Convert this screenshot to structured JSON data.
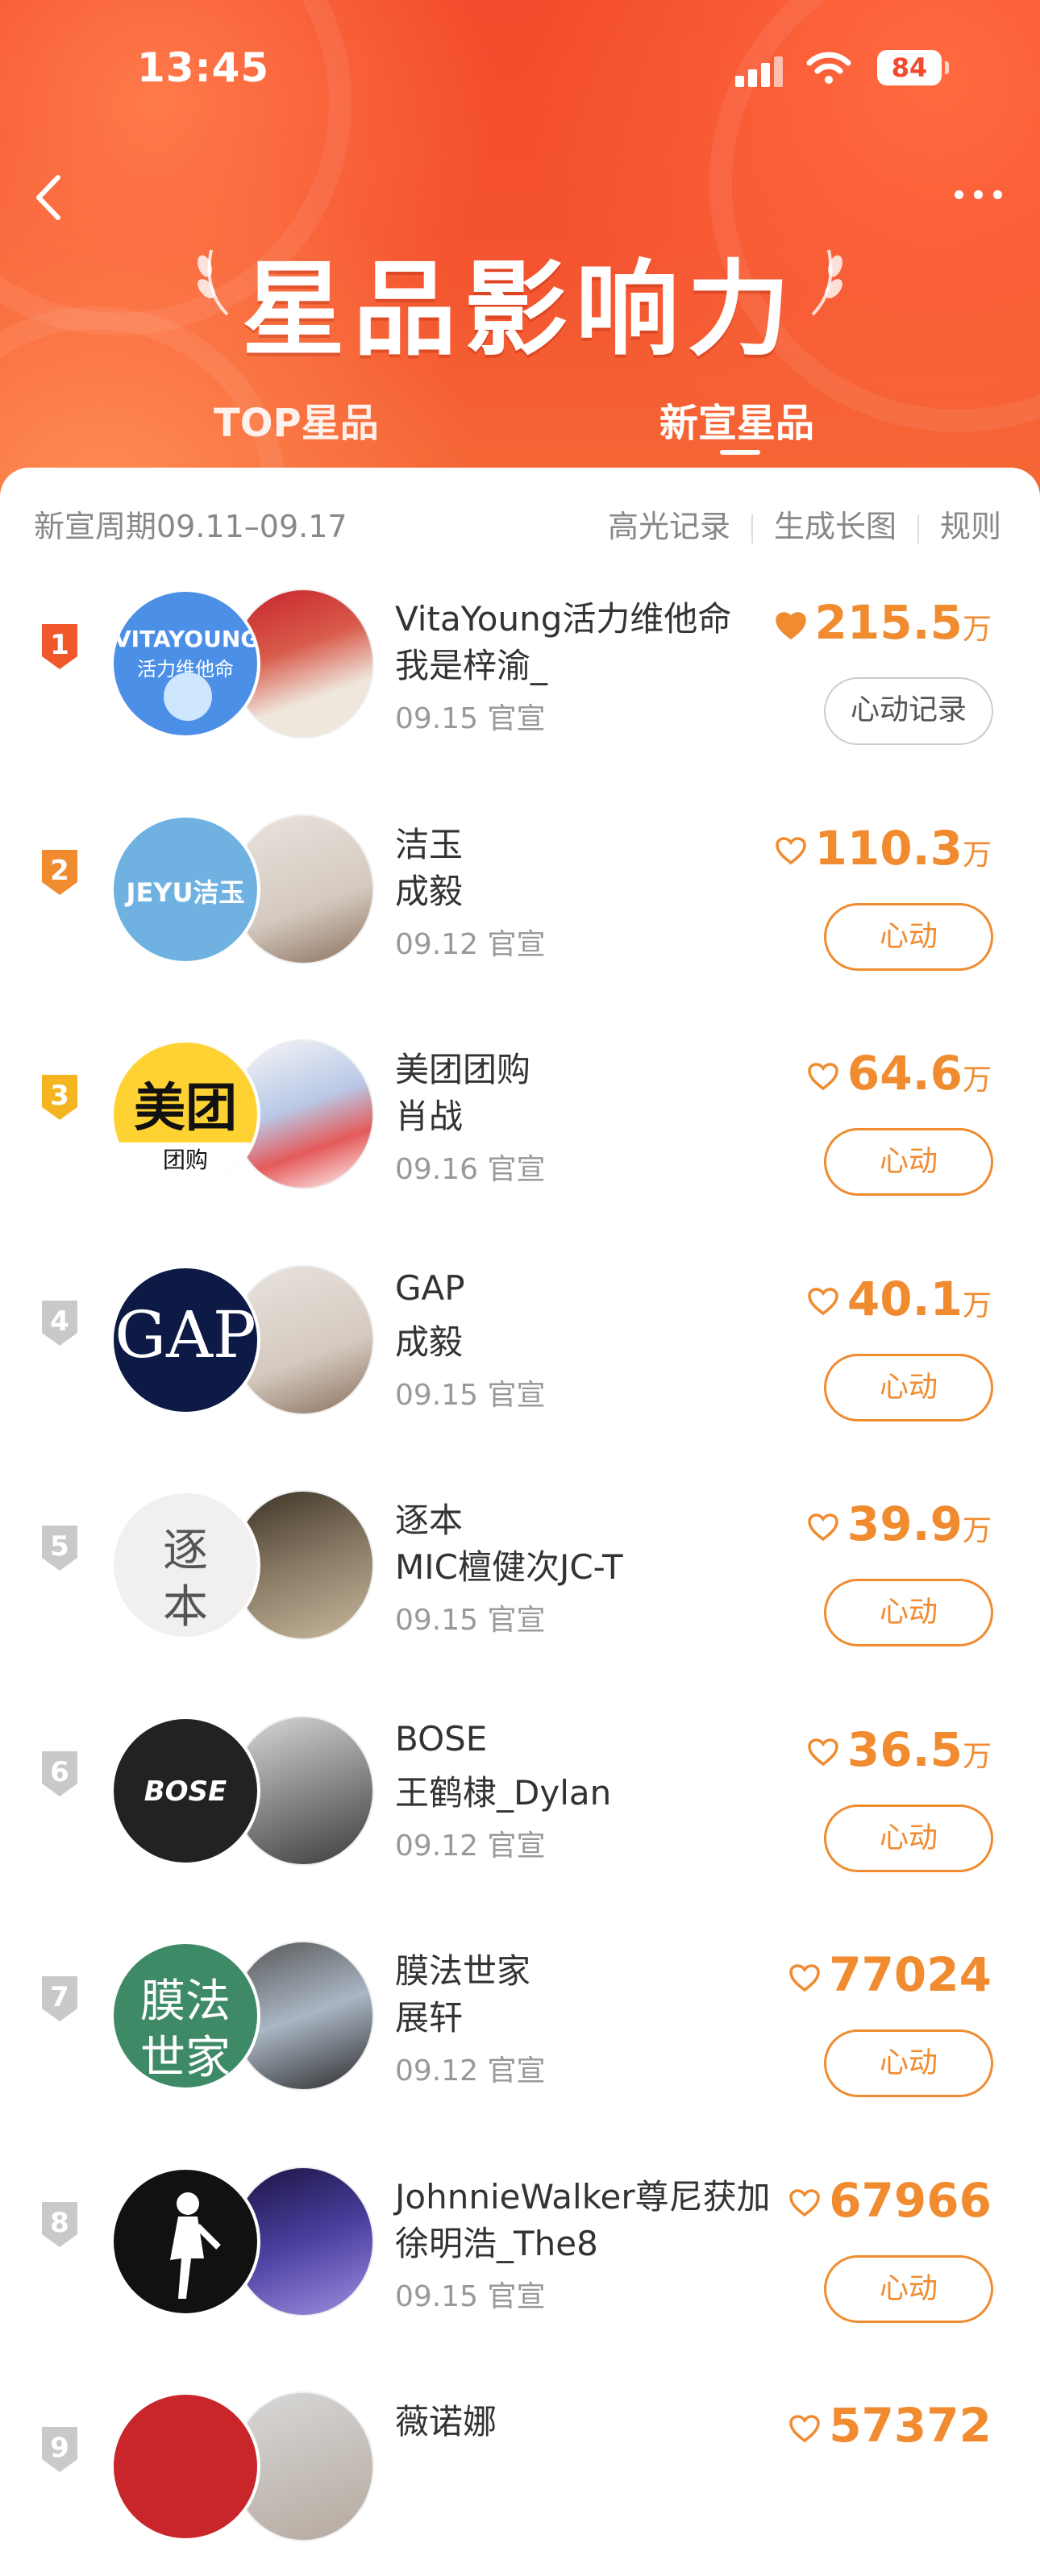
{
  "status": {
    "time": "13:45",
    "battery": "84"
  },
  "header": {
    "title": "星品影响力",
    "tabs": [
      "TOP星品",
      "新宣星品"
    ],
    "active_tab": 1
  },
  "info": {
    "cycle": "新宣周期09.11–09.17",
    "links": [
      "高光记录",
      "生成长图",
      "规则"
    ]
  },
  "colors": {
    "accent": "#f08b30",
    "header": "#f24a2c"
  },
  "items": [
    {
      "rank": "1",
      "brand": "VitaYoung活力维他命",
      "star": "我是梓渝_",
      "date": "09.15 官宣",
      "score": "215.5",
      "unit": "万",
      "button": "心动记录",
      "logo_text": "VITAYOUNG",
      "logo_sub": "活力维他命"
    },
    {
      "rank": "2",
      "brand": "洁玉",
      "star": "成毅",
      "date": "09.12 官宣",
      "score": "110.3",
      "unit": "万",
      "button": "心动",
      "logo_text": "JEYU洁玉"
    },
    {
      "rank": "3",
      "brand": "美团团购",
      "star": "肖战",
      "date": "09.16 官宣",
      "score": "64.6",
      "unit": "万",
      "button": "心动",
      "logo_text": "美团",
      "logo_sub": "团购"
    },
    {
      "rank": "4",
      "brand": "GAP",
      "star": "成毅",
      "date": "09.15 官宣",
      "score": "40.1",
      "unit": "万",
      "button": "心动",
      "logo_text": "GAP"
    },
    {
      "rank": "5",
      "brand": "逐本",
      "star": "MIC檀健次JC-T",
      "date": "09.15 官宣",
      "score": "39.9",
      "unit": "万",
      "button": "心动",
      "logo_text": "逐",
      "logo_sub": "本"
    },
    {
      "rank": "6",
      "brand": "BOSE",
      "star": "王鹤棣_Dylan",
      "date": "09.12 官宣",
      "score": "36.5",
      "unit": "万",
      "button": "心动",
      "logo_text": "BOSE"
    },
    {
      "rank": "7",
      "brand": "膜法世家",
      "star": "展轩",
      "date": "09.12 官宣",
      "score": "77024",
      "unit": "",
      "button": "心动",
      "logo_text": "膜法",
      "logo_sub": "世家"
    },
    {
      "rank": "8",
      "brand": "JohnnieWalker尊尼获加",
      "star": "徐明浩_The8",
      "date": "09.15 官宣",
      "score": "67966",
      "unit": "",
      "button": "心动"
    },
    {
      "rank": "9",
      "brand": "薇诺娜",
      "star": "",
      "date": "",
      "score": "57372",
      "unit": "",
      "button": ""
    }
  ]
}
